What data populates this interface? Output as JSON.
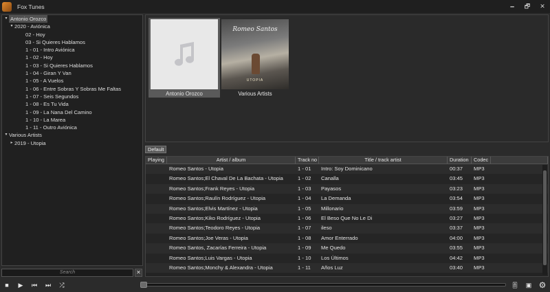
{
  "window": {
    "title": "Fox Tunes",
    "minimize": "🗕",
    "maximize": "🗗",
    "close": "✕"
  },
  "library": {
    "tree": [
      {
        "label": "Antonio Orozco",
        "level": 0,
        "arrow": "▾",
        "selected": true
      },
      {
        "label": "2020 - Aviónica",
        "level": 1,
        "arrow": "▾",
        "selected": false
      },
      {
        "label": "02 - Hoy",
        "level": 2,
        "arrow": "",
        "selected": false
      },
      {
        "label": "03 - Si Quieres Hablamos",
        "level": 2,
        "arrow": "",
        "selected": false
      },
      {
        "label": "1 - 01 - Intro Aviónica",
        "level": 2,
        "arrow": "",
        "selected": false
      },
      {
        "label": "1 - 02 - Hoy",
        "level": 2,
        "arrow": "",
        "selected": false
      },
      {
        "label": "1 - 03 - Si Quieres Hablamos",
        "level": 2,
        "arrow": "",
        "selected": false
      },
      {
        "label": "1 - 04 - Giran Y Van",
        "level": 2,
        "arrow": "",
        "selected": false
      },
      {
        "label": "1 - 05 - A Vuelos",
        "level": 2,
        "arrow": "",
        "selected": false
      },
      {
        "label": "1 - 06 - Entre Sobras Y Sobras Me Faltas",
        "level": 2,
        "arrow": "",
        "selected": false
      },
      {
        "label": "1 - 07 - Seis Segundos",
        "level": 2,
        "arrow": "",
        "selected": false
      },
      {
        "label": "1 - 08 - Es Tu Vida",
        "level": 2,
        "arrow": "",
        "selected": false
      },
      {
        "label": "1 - 09 - La Nana Del Camino",
        "level": 2,
        "arrow": "",
        "selected": false
      },
      {
        "label": "1 - 10 - La Marea",
        "level": 2,
        "arrow": "",
        "selected": false
      },
      {
        "label": "1 - 11 - Outro Aviónica",
        "level": 2,
        "arrow": "",
        "selected": false
      },
      {
        "label": "Various Artists",
        "level": 0,
        "arrow": "▾",
        "selected": false
      },
      {
        "label": "2019 - Utopia",
        "level": 1,
        "arrow": "▸",
        "selected": false
      }
    ],
    "search_placeholder": "Search",
    "search_clear": "✕"
  },
  "albums": [
    {
      "caption": "Antonio Orozco",
      "selected": true,
      "art": "music-note-placeholder"
    },
    {
      "caption": "Various Artists",
      "selected": false,
      "art": "cover",
      "cover_title": "Romeo Santos",
      "cover_foot": "UTOPIA"
    }
  ],
  "playlist": {
    "tabs": [
      "Default"
    ],
    "columns": [
      "Playing",
      "Artist / album",
      "Track no",
      "Title / track artist",
      "Duration",
      "Codec"
    ],
    "rows": [
      {
        "playing": "",
        "artist": "Romeo Santos - Utopia",
        "track": "1 - 01",
        "title": "Intro: Soy Dominicano",
        "duration": "00:37",
        "codec": "MP3"
      },
      {
        "playing": "",
        "artist": "Romeo Santos;El Chaval De La Bachata - Utopia",
        "track": "1 - 02",
        "title": "Canalla",
        "duration": "03:45",
        "codec": "MP3"
      },
      {
        "playing": "",
        "artist": "Romeo Santos;Frank Reyes - Utopia",
        "track": "1 - 03",
        "title": "Payasos",
        "duration": "03:23",
        "codec": "MP3"
      },
      {
        "playing": "",
        "artist": "Romeo Santos;Raulín Rodríguez - Utopia",
        "track": "1 - 04",
        "title": "La Demanda",
        "duration": "03:54",
        "codec": "MP3"
      },
      {
        "playing": "",
        "artist": "Romeo Santos;Elvis Martínez - Utopia",
        "track": "1 - 05",
        "title": "Millonario",
        "duration": "03:59",
        "codec": "MP3"
      },
      {
        "playing": "",
        "artist": "Romeo Santos;Kiko Rodríguez - Utopia",
        "track": "1 - 06",
        "title": "El Beso Que No Le Di",
        "duration": "03:27",
        "codec": "MP3"
      },
      {
        "playing": "",
        "artist": "Romeo Santos;Teodoro Reyes - Utopia",
        "track": "1 - 07",
        "title": "ileso",
        "duration": "03:37",
        "codec": "MP3"
      },
      {
        "playing": "",
        "artist": "Romeo Santos;Joe Veras - Utopia",
        "track": "1 - 08",
        "title": "Amor Enterrado",
        "duration": "04:00",
        "codec": "MP3"
      },
      {
        "playing": "",
        "artist": "Romeo Santos, Zacarías Ferreira - Utopia",
        "track": "1 - 09",
        "title": "Me Quedo",
        "duration": "03:55",
        "codec": "MP3"
      },
      {
        "playing": "",
        "artist": "Romeo Santos;Luis Vargas - Utopia",
        "track": "1 - 10",
        "title": "Los Últimos",
        "duration": "04:42",
        "codec": "MP3"
      },
      {
        "playing": "",
        "artist": "Romeo Santos;Monchy & Alexandra - Utopia",
        "track": "1 - 11",
        "title": "Años Luz",
        "duration": "03:40",
        "codec": "MP3"
      }
    ]
  },
  "transport": {
    "stop": "■",
    "play": "▶",
    "previous": "⏮",
    "next": "⏭",
    "shuffle": "⤮",
    "seek_position": 0,
    "equalizer": "🎚",
    "mini_view": "▣",
    "settings": "⚙"
  }
}
